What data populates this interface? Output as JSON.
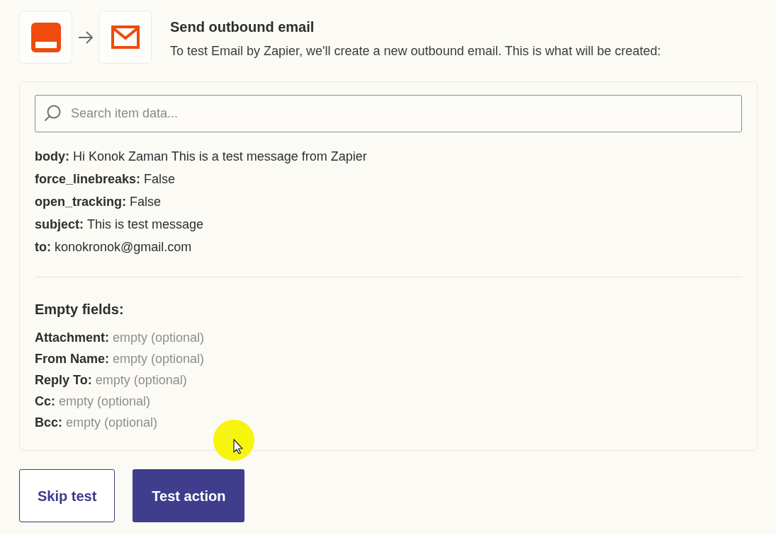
{
  "header": {
    "title": "Send outbound email",
    "description": "To test Email by Zapier, we'll create a new outbound email. This is what will be created:"
  },
  "search": {
    "placeholder": "Search item data..."
  },
  "fields": [
    {
      "label": "body:",
      "value": "Hi Konok Zaman This is a test message from Zapier"
    },
    {
      "label": "force_linebreaks:",
      "value": "False"
    },
    {
      "label": "open_tracking:",
      "value": "False"
    },
    {
      "label": "subject:",
      "value": "This is test message"
    },
    {
      "label": "to:",
      "value": "konokronok@gmail.com"
    }
  ],
  "empty_fields": {
    "heading": "Empty fields:",
    "items": [
      {
        "label": "Attachment:",
        "value": "empty (optional)"
      },
      {
        "label": "From Name:",
        "value": "empty (optional)"
      },
      {
        "label": "Reply To:",
        "value": "empty (optional)"
      },
      {
        "label": "Cc:",
        "value": "empty (optional)"
      },
      {
        "label": "Bcc:",
        "value": "empty (optional)"
      }
    ]
  },
  "buttons": [
    {
      "label": "Skip test",
      "kind": "secondary"
    },
    {
      "label": "Test action",
      "kind": "primary"
    }
  ]
}
